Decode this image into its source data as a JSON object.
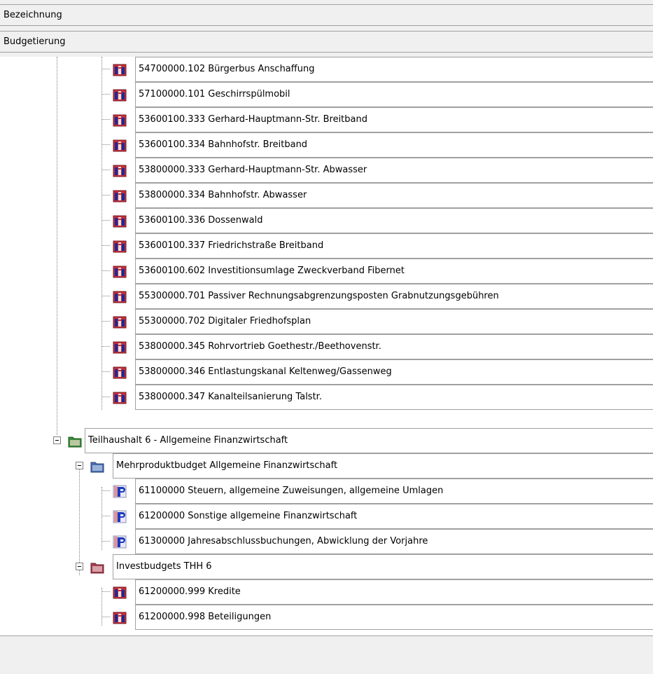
{
  "columns": {
    "bezeichnung": "Bezeichnung",
    "budgetierung": "Budgetierung"
  },
  "tree": {
    "invest_items_a": [
      "54700000.102 Bürgerbus Anschaffung",
      "57100000.101 Geschirrspülmobil",
      "53600100.333 Gerhard-Hauptmann-Str. Breitband",
      "53600100.334 Bahnhofstr. Breitband",
      "53800000.333 Gerhard-Hauptmann-Str. Abwasser",
      "53800000.334 Bahnhofstr. Abwasser",
      "53600100.336 Dossenwald",
      "53600100.337 Friedrichstraße Breitband",
      "53600100.602 Investitionsumlage Zweckverband Fibernet",
      "55300000.701 Passiver Rechnungsabgrenzungsposten  Grabnutzungsgebühren",
      "55300000.702 Digitaler Friedhofsplan",
      "53800000.345 Rohrvortrieb Goethestr./Beethovenstr.",
      "53800000.346 Entlastungskanal Keltenweg/Gassenweg",
      "53800000.347 Kanalteilsanierung Talstr."
    ],
    "teilhaushalt6": "Teilhaushalt 6 - Allgemeine Finanzwirtschaft",
    "mehrprodukt": "Mehrproduktbudget Allgemeine Finanzwirtschaft",
    "product_items": [
      "61100000 Steuern, allgemeine Zuweisungen, allgemeine Umlagen",
      "61200000 Sonstige allgemeine Finanzwirtschaft",
      "61300000 Jahresabschlussbuchungen, Abwicklung der Vorjahre"
    ],
    "investbudgets": "Investbudgets THH 6",
    "invest_items_b": [
      "61200000.999 Kredite",
      "61200000.998 Beteiligungen"
    ]
  },
  "icons": {
    "invest": "invest-project-icon",
    "product": "product-p-icon",
    "teilhaushalt": "green-folder-icon",
    "mehrprodukt": "blue-folder-icon",
    "investbudget": "red-folder-icon"
  },
  "colors": {
    "grid_border": "#a0a0a0",
    "panel_bg": "#f0f0f0",
    "tree_bg": "#ffffff"
  }
}
